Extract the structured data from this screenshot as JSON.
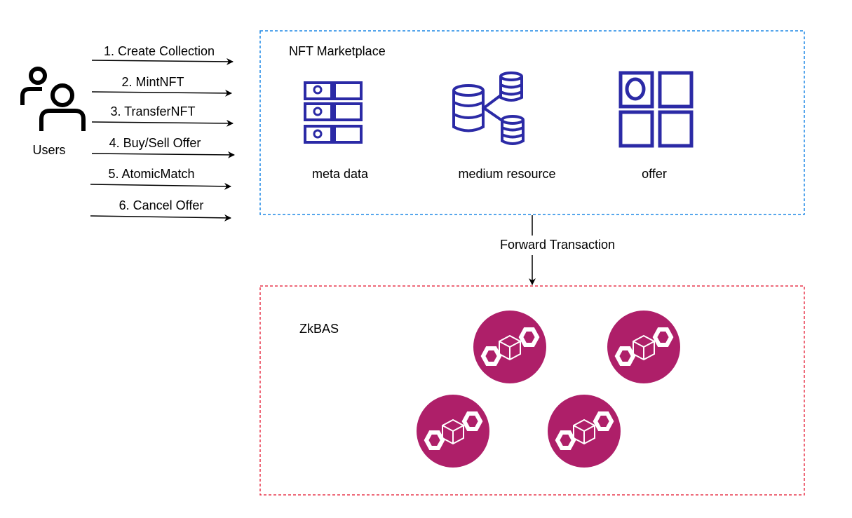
{
  "users": {
    "label": "Users",
    "icon": "users-icon"
  },
  "actions": [
    {
      "label": "1. Create Collection"
    },
    {
      "label": "2. MintNFT"
    },
    {
      "label": "3. TransferNFT"
    },
    {
      "label": "4. Buy/Sell Offer"
    },
    {
      "label": "5. AtomicMatch"
    },
    {
      "label": "6. Cancel Offer"
    }
  ],
  "marketplace": {
    "title": "NFT Marketplace",
    "border_color": "#1e88e5",
    "components": [
      {
        "label": "meta data",
        "icon": "metadata-grid-icon"
      },
      {
        "label": "medium resource",
        "icon": "database-share-icon"
      },
      {
        "label": "offer",
        "icon": "offer-grid-icon"
      }
    ]
  },
  "forward": {
    "label": "Forward Transaction"
  },
  "zkbas": {
    "title": "ZkBAS",
    "border_color": "#e8384f",
    "node_color": "#ae1f69",
    "node_icon": "blockchain-node-icon",
    "node_count": 4
  },
  "icon_color": "#2b2aa6"
}
